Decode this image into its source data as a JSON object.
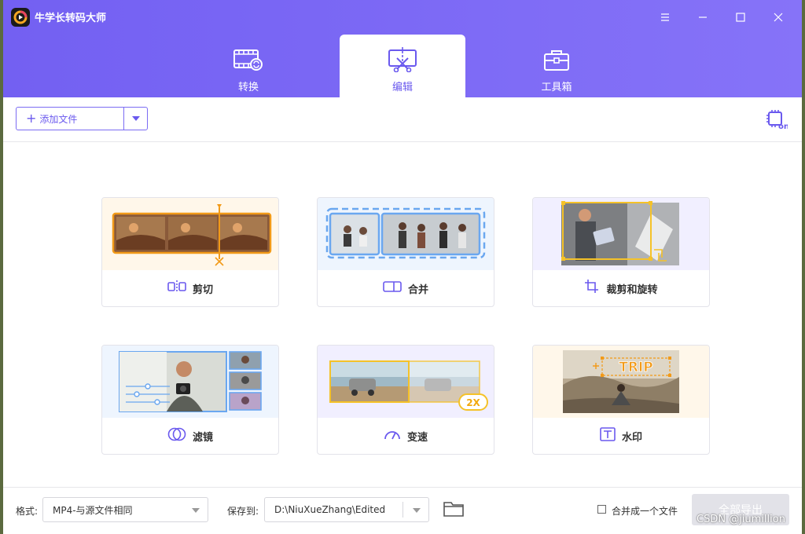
{
  "app": {
    "title": "牛学长转码大师"
  },
  "tabs": [
    {
      "label": "转换",
      "icon": "convert-film-icon"
    },
    {
      "label": "编辑",
      "icon": "edit-scissors-icon",
      "active": true
    },
    {
      "label": "工具箱",
      "icon": "toolbox-icon"
    }
  ],
  "toolbar": {
    "add_file_label": "添加文件"
  },
  "cards": [
    {
      "label": "剪切",
      "icon": "cut-icon"
    },
    {
      "label": "合并",
      "icon": "merge-icon"
    },
    {
      "label": "裁剪和旋转",
      "icon": "crop-rotate-icon"
    },
    {
      "label": "滤镜",
      "icon": "filter-icon"
    },
    {
      "label": "变速",
      "icon": "speed-icon",
      "badge": "2X"
    },
    {
      "label": "水印",
      "icon": "watermark-icon",
      "overlay_text": "TRIP"
    }
  ],
  "bottom": {
    "format_label": "格式:",
    "format_value": "MP4-与源文件相同",
    "save_label": "保存到:",
    "save_path": "D:\\NiuXueZhang\\Edited",
    "merge_label": "合并成一个文件",
    "export_label": "全部导出"
  },
  "watermark_text": "CSDN @jiumillion",
  "colors": {
    "accent": "#7360f2",
    "orange": "#f29a18",
    "blue": "#6aa7f0",
    "yellow": "#f5c228"
  }
}
